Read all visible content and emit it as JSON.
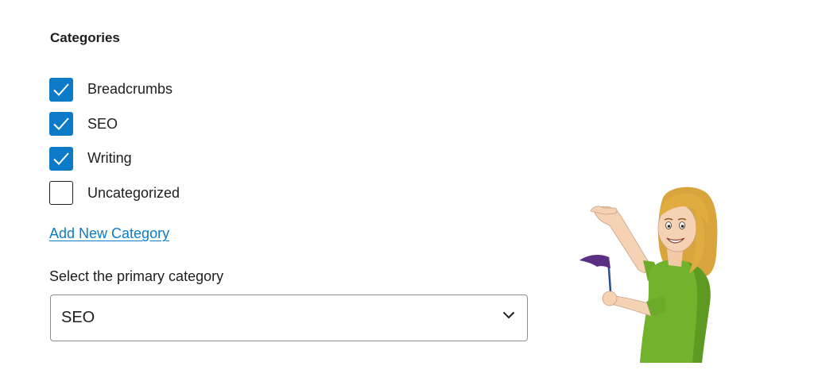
{
  "categories_panel": {
    "title": "Categories",
    "items": [
      {
        "label": "Breadcrumbs",
        "checked": true
      },
      {
        "label": "SEO",
        "checked": true
      },
      {
        "label": "Writing",
        "checked": true
      },
      {
        "label": "Uncategorized",
        "checked": false
      }
    ],
    "add_new_link": "Add New Category"
  },
  "primary_category": {
    "label": "Select the primary category",
    "selected_value": "SEO",
    "dropdown_icon": "chevron-down-icon"
  },
  "colors": {
    "accent": "#0b7bc8",
    "text": "#1e1e1e",
    "border": "#8d8f94"
  },
  "illustration": {
    "description_icon": "woman-with-flag-illustration"
  }
}
